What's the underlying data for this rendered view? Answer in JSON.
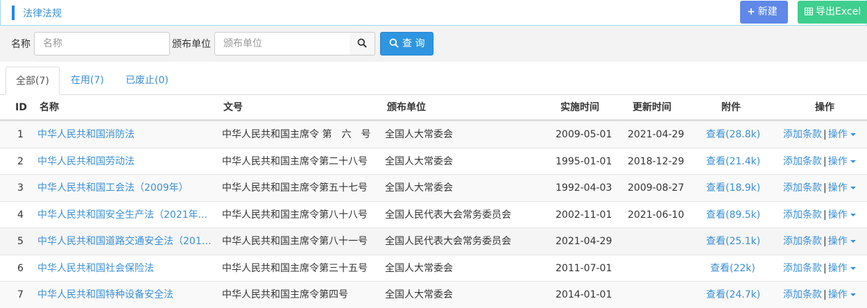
{
  "header": {
    "title": "法律法规",
    "new_label": "新建",
    "export_label": "导出Excel"
  },
  "search": {
    "name_label": "名称",
    "name_placeholder": "名称",
    "unit_label": "颁布单位",
    "unit_placeholder": "颁布单位",
    "query_label": "查 询"
  },
  "tabs": [
    {
      "label": "全部(7)"
    },
    {
      "label": "在用(7)"
    },
    {
      "label": "已废止(0)"
    }
  ],
  "columns": {
    "id": "ID",
    "name": "名称",
    "doc": "文号",
    "unit": "颁布单位",
    "effective": "实施时间",
    "updated": "更新时间",
    "attach": "附件",
    "ops": "操作"
  },
  "rows": [
    {
      "id": "1",
      "name": "中华人民共和国消防法",
      "doc": "中华人民共和国主席令 第　六　号",
      "unit": "全国人大常委会",
      "effective": "2009-05-01",
      "updated": "2021-04-29",
      "attach": "查看(28.8k)",
      "add": "添加条款",
      "op": "操作"
    },
    {
      "id": "2",
      "name": "中华人民共和国劳动法",
      "doc": "中华人民共和国主席令第二十八号",
      "unit": "全国人大常委会",
      "effective": "1995-01-01",
      "updated": "2018-12-29",
      "attach": "查看(21.4k)",
      "add": "添加条款",
      "op": "操作"
    },
    {
      "id": "3",
      "name": "中华人民共和国工会法（2009年）",
      "doc": "中华人民共和国主席令第五十七号",
      "unit": "全国人大常委会",
      "effective": "1992-04-03",
      "updated": "2009-08-27",
      "attach": "查看(18.9k)",
      "add": "添加条款",
      "op": "操作"
    },
    {
      "id": "4",
      "name": "中华人民共和国安全生产法（2021年...",
      "doc": "中华人民共和国主席令第八十八号",
      "unit": "全国人民代表大会常务委员会",
      "effective": "2002-11-01",
      "updated": "2021-06-10",
      "attach": "查看(89.5k)",
      "add": "添加条款",
      "op": "操作"
    },
    {
      "id": "5",
      "name": "中华人民共和国道路交通安全法（2011...",
      "doc": "中华人民共和国主席令第八十一号",
      "unit": "全国人民代表大会常务委员会",
      "effective": "2021-04-29",
      "updated": "",
      "attach": "查看(25.1k)",
      "add": "添加条款",
      "op": "操作"
    },
    {
      "id": "6",
      "name": "中华人民共和国社会保险法",
      "doc": "中华人民共和国主席令第三十五号",
      "unit": "全国人大常委会",
      "effective": "2011-07-01",
      "updated": "",
      "attach": "查看(22k)",
      "add": "添加条款",
      "op": "操作"
    },
    {
      "id": "7",
      "name": "中华人民共和国特种设备安全法",
      "doc": "中华人民共和国主席令第四号",
      "unit": "全国人大常委会",
      "effective": "2014-01-01",
      "updated": "",
      "attach": "查看(24.7k)",
      "add": "添加条款",
      "op": "操作"
    }
  ]
}
